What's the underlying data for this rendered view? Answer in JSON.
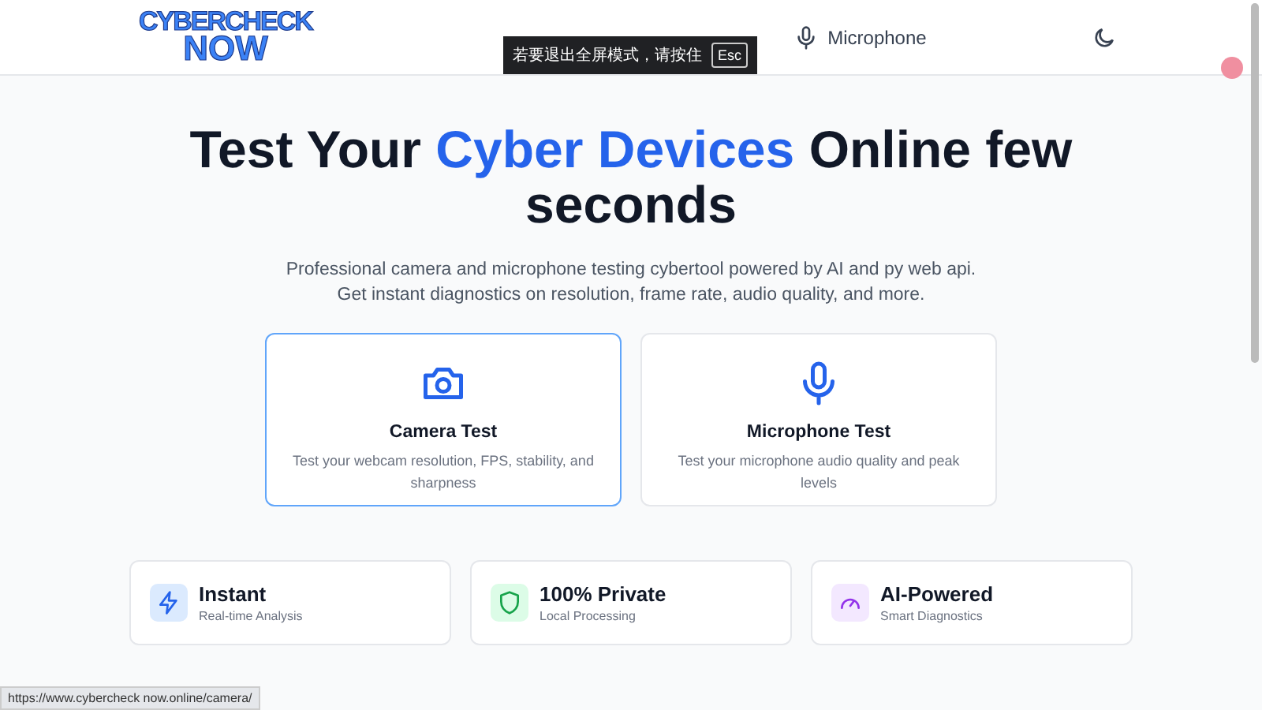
{
  "header": {
    "logo_line_1": "CYBERCHECK",
    "logo_line_2": "NOW",
    "nav": [
      {
        "kind": "mic",
        "label": "Microphone"
      }
    ]
  },
  "toast": {
    "text": "若要退出全屏模式，请按住",
    "key": "Esc"
  },
  "hero": {
    "title_before": "Test Your ",
    "title_highlight": "Cyber Devices",
    "title_after": " Online few seconds",
    "subtitle": "Professional camera and microphone testing cybertool powered by AI and py web api. Get instant diagnostics on resolution, frame rate, audio quality, and more."
  },
  "tests": [
    {
      "kind": "camera",
      "title": "Camera Test",
      "description": "Test your webcam resolution, FPS, stability, and sharpness",
      "selected": true
    },
    {
      "kind": "mic",
      "title": "Microphone Test",
      "description": "Test your microphone audio quality and peak levels",
      "selected": false
    }
  ],
  "features": [
    {
      "kind": "bolt",
      "title": "Instant",
      "subtitle": "Real-time Analysis",
      "color": "#dbeafe"
    },
    {
      "kind": "shield",
      "title": "100% Private",
      "subtitle": "Local Processing",
      "color": "#dcfce7"
    },
    {
      "kind": "gauge",
      "title": "AI-Powered",
      "subtitle": "Smart Diagnostics",
      "color": "#f3e8ff"
    }
  ],
  "status_url": "https://www.cybercheck now.online/camera/"
}
